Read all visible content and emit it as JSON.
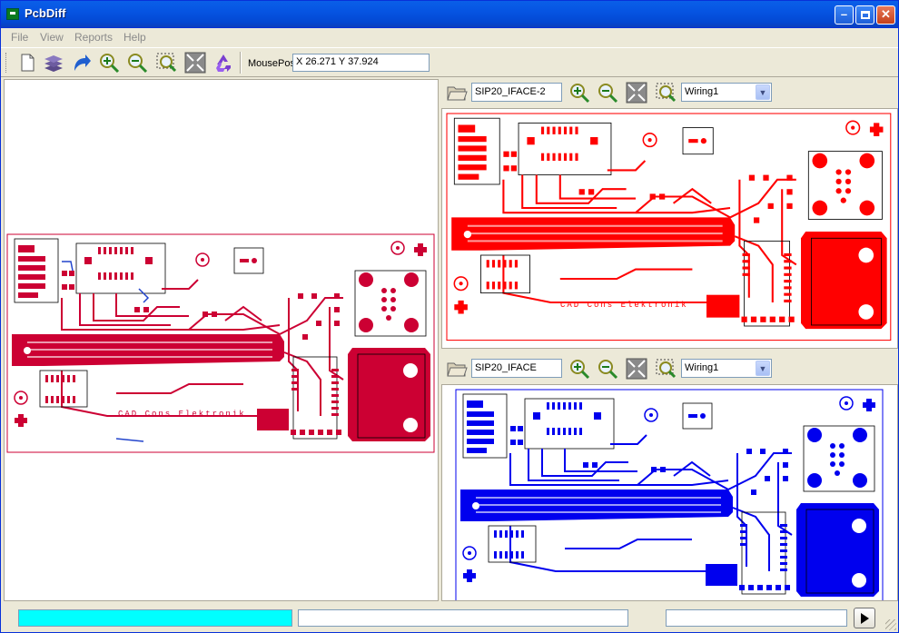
{
  "window": {
    "title": "PcbDiff"
  },
  "menu": [
    "File",
    "View",
    "Reports",
    "Help"
  ],
  "toolbar": {
    "mousepos_label": "MousePos",
    "mousepos_value": "X 26.271 Y 37.924"
  },
  "panels": [
    {
      "name": "SIP20_IFACE-2",
      "layer": "Wiring1",
      "color": "#ff0000"
    },
    {
      "name": "SIP20_IFACE",
      "layer": "Wiring1",
      "color": "#0000ff"
    }
  ],
  "overview": {
    "color": "#cc0033"
  },
  "pcb_label": "CAD Cons Elektronik",
  "status": {
    "progress": 1.0,
    "accent": "#00ffff"
  }
}
